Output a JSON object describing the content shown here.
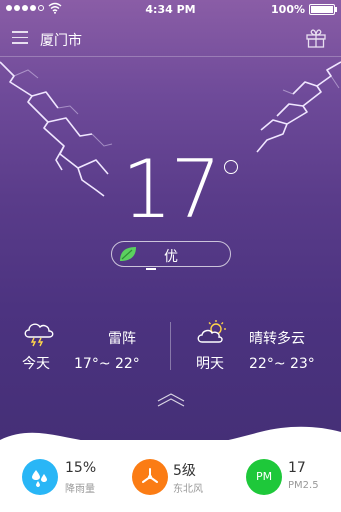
{
  "status_bar": {
    "time": "4:34 PM",
    "battery": "100%",
    "signal_dots": 5,
    "signal_filled": 4
  },
  "header": {
    "city": "厦门市"
  },
  "current": {
    "temperature": "17"
  },
  "air_quality": {
    "label": "优"
  },
  "today": {
    "condition": "雷阵",
    "day": "今天",
    "range": "17°~ 22°"
  },
  "tomorrow": {
    "condition": "晴转多云",
    "day": "明天",
    "range": "22°~ 23°"
  },
  "stats": [
    {
      "value": "15%",
      "label": "降雨量",
      "icon": "raindrop-icon",
      "color": "#29b6f6"
    },
    {
      "value": "5级",
      "label": "东北风",
      "icon": "fan-icon",
      "color": "#fb7c14"
    },
    {
      "value": "17",
      "label": "PM2.5",
      "icon": "pm-icon",
      "icon_text": "PM",
      "color": "#1ec83a"
    }
  ],
  "colors": {
    "sky_top": "#8a5da6",
    "sky_bottom": "#452f77"
  }
}
